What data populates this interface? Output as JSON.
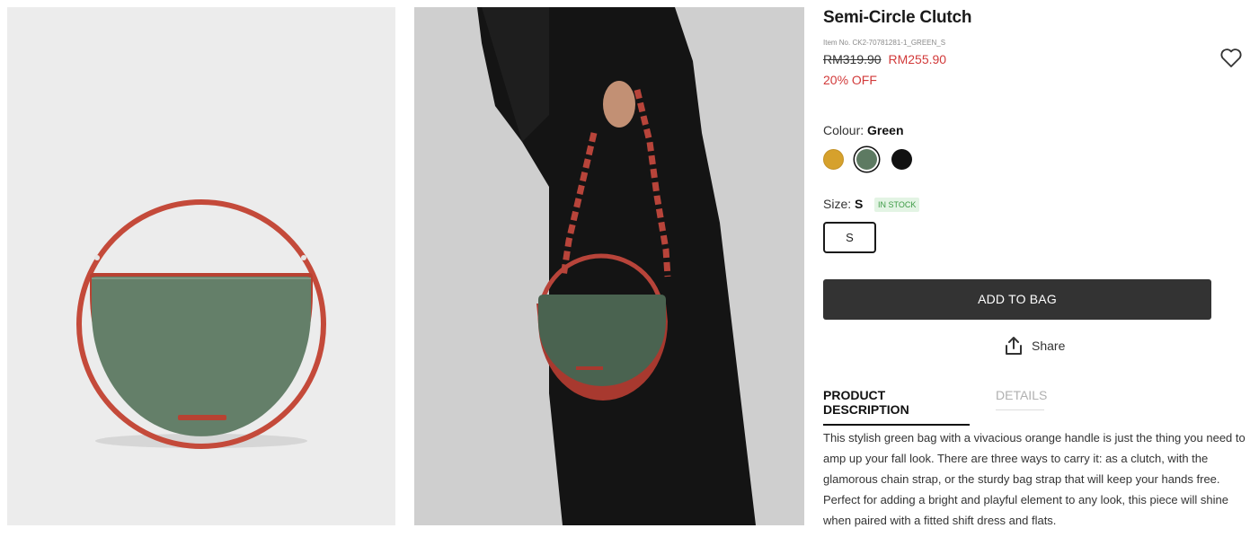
{
  "product": {
    "title": "Semi-Circle Clutch",
    "item_no": "Item No. CK2-70781281-1_GREEN_S",
    "old_price": "RM319.90",
    "new_price": "RM255.90",
    "discount": "20% OFF"
  },
  "colour": {
    "label": "Colour:",
    "selected": "Green",
    "swatches": [
      "#d6a12c",
      "#5d7a62",
      "#111111"
    ]
  },
  "size": {
    "label": "Size:",
    "selected": "S",
    "stock": "IN STOCK",
    "options": [
      "S"
    ]
  },
  "actions": {
    "add_to_bag": "ADD TO BAG",
    "share": "Share"
  },
  "tabs": {
    "description": "PRODUCT DESCRIPTION",
    "details": "DETAILS"
  },
  "description": "This stylish green bag with a vivacious orange handle is just the thing you need to amp up your fall look. There are three ways to carry it: as a clutch, with the glamorous chain strap, or the sturdy bag strap that will keep your hands free. Perfect for adding a bright and playful element to any look, this piece will shine when paired with a fitted shift dress and flats.",
  "colors": {
    "accent_red": "#d23a3a",
    "button_dark": "#333333",
    "stock_green": "#3c9a45"
  }
}
